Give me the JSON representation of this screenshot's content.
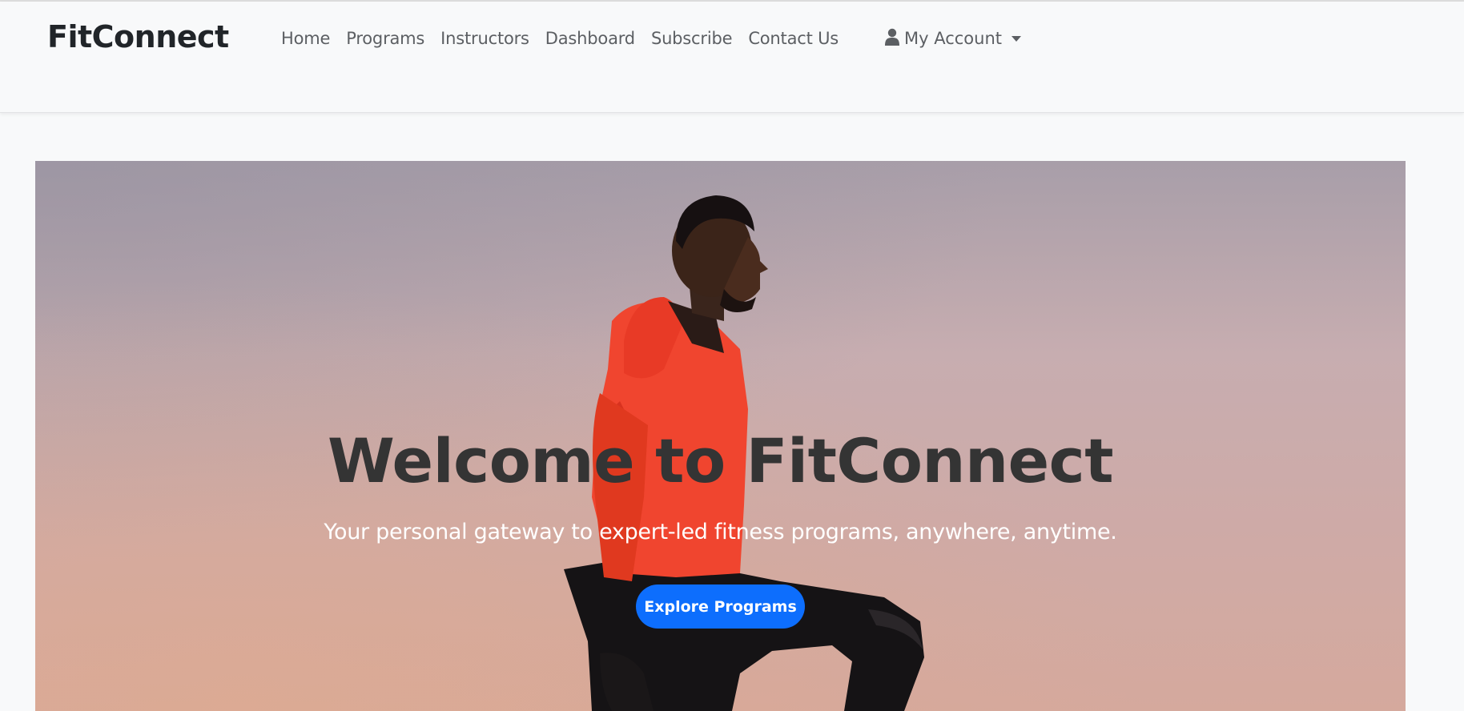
{
  "navbar": {
    "brand": "FitConnect",
    "links": [
      {
        "label": "Home"
      },
      {
        "label": "Programs"
      },
      {
        "label": "Instructors"
      },
      {
        "label": "Dashboard"
      },
      {
        "label": "Subscribe"
      },
      {
        "label": "Contact Us"
      }
    ],
    "account": {
      "label": "My Account",
      "icon": "user-icon",
      "dropdown_icon": "caret-down-icon"
    }
  },
  "hero": {
    "title": "Welcome to FitConnect",
    "subtitle": "Your personal gateway to expert-led fitness programs, anywhere, anytime.",
    "cta_label": "Explore Programs",
    "cta_color": "#0d6efd"
  }
}
